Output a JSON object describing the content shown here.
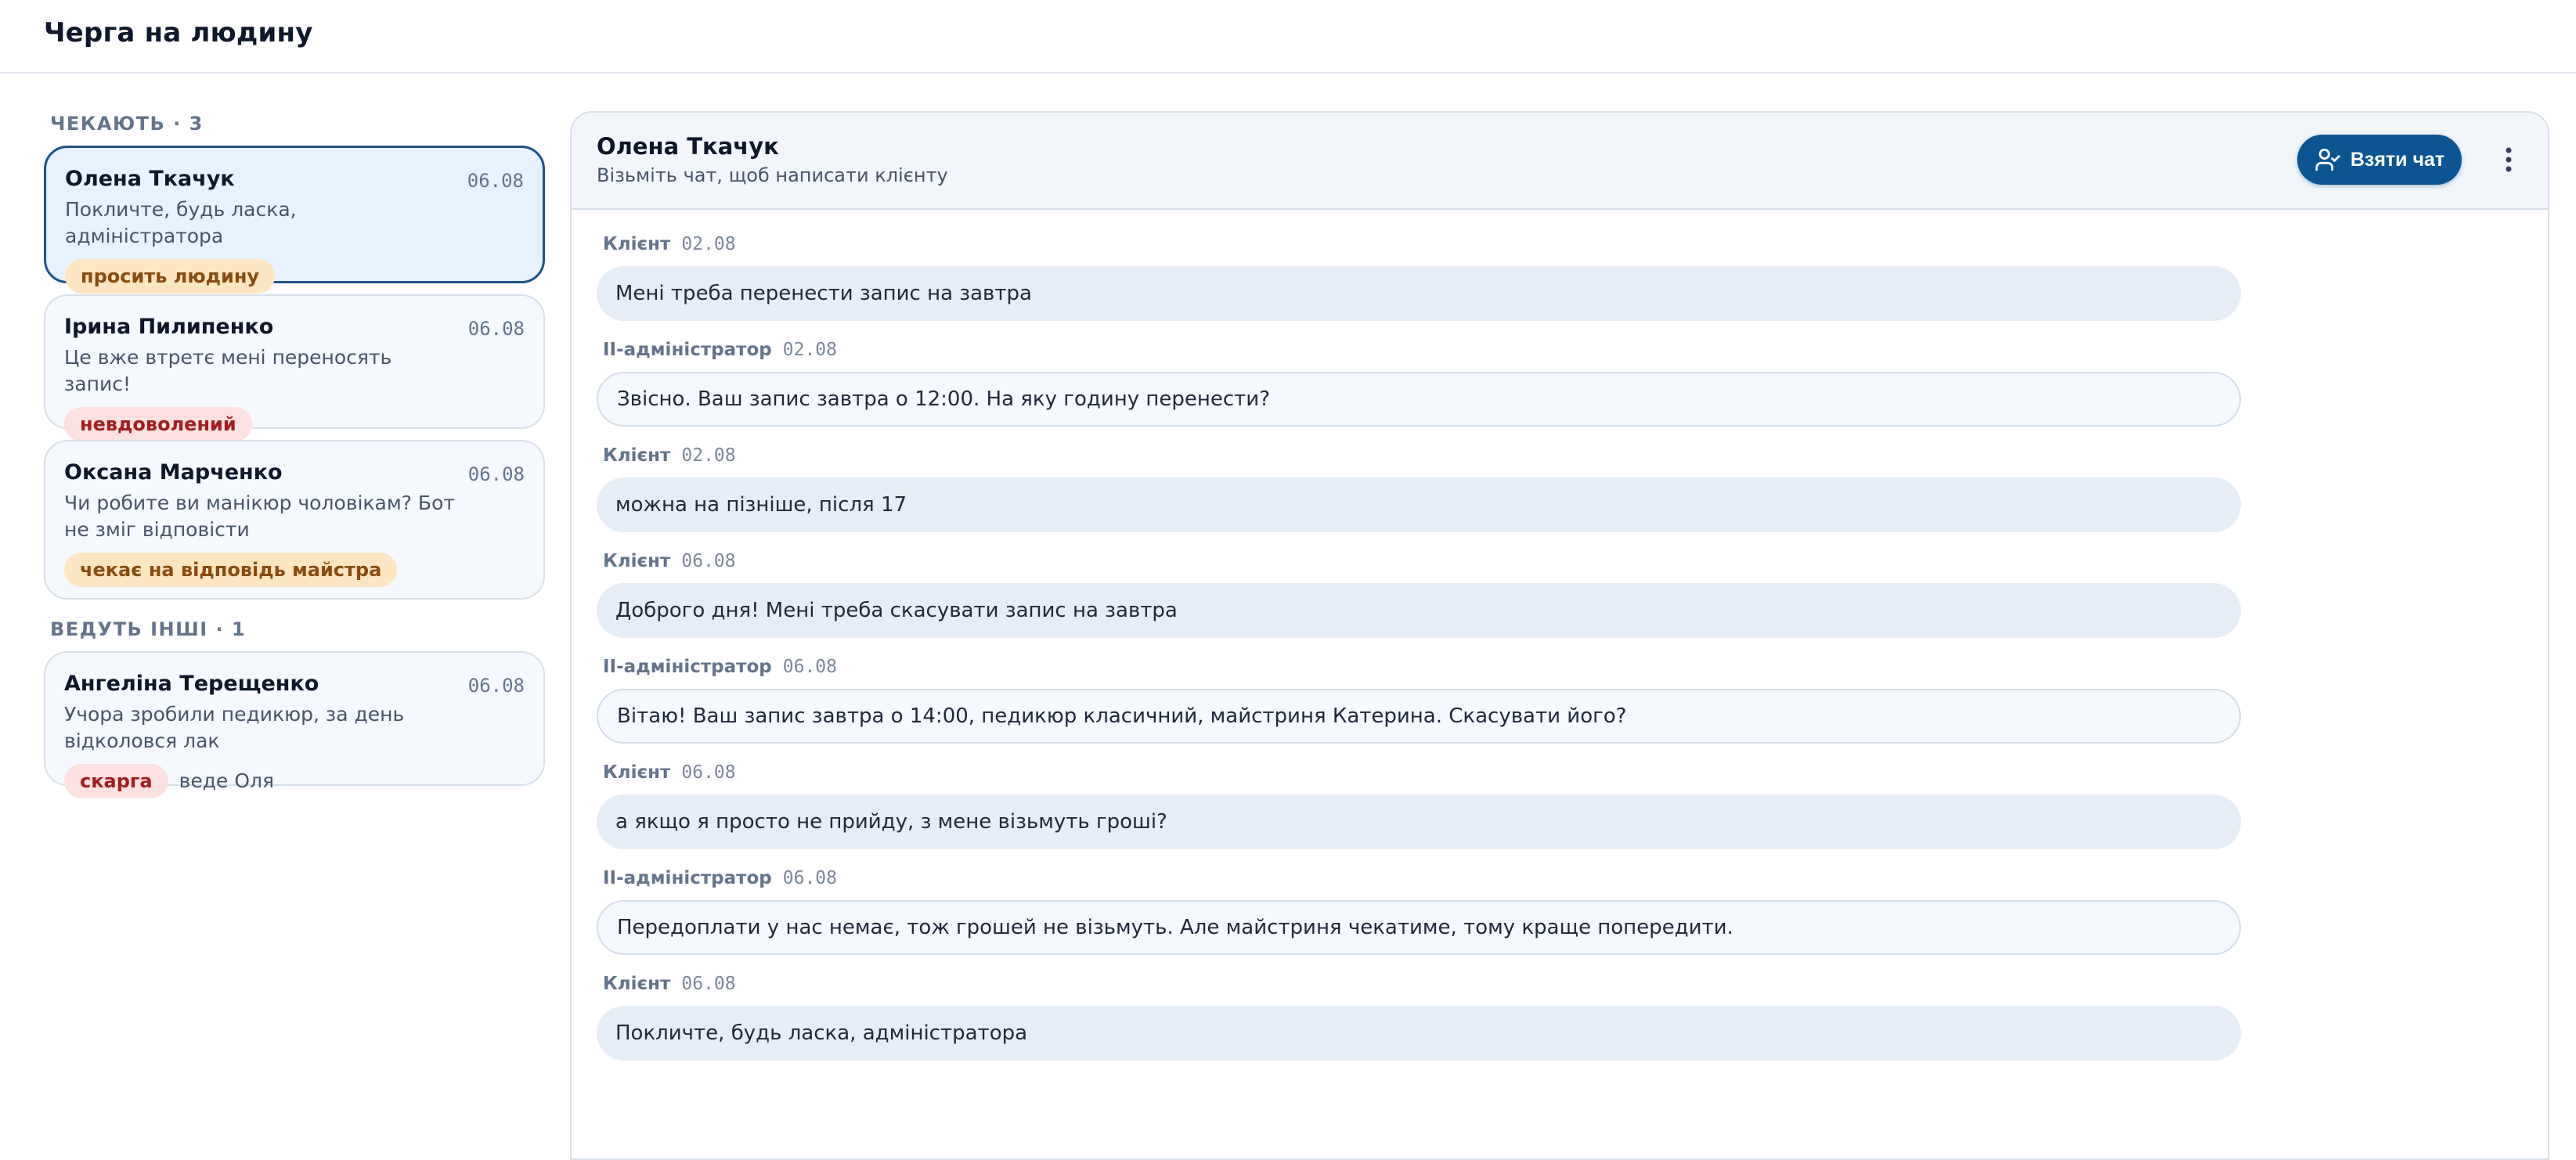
{
  "header": {
    "title": "Черга на людину"
  },
  "queue": {
    "waiting_label": "ЧЕКАЮТЬ · 3",
    "others_label": "ВЕДУТЬ ІНШІ · 1",
    "waiting": [
      {
        "name": "Олена Ткачук",
        "date": "06.08",
        "preview": "Покличте, будь ласка, адміністратора",
        "tag": "просить людину",
        "tag_color": "#fde5c2"
      },
      {
        "name": "Ірина Пилипенко",
        "date": "06.08",
        "preview": "Це вже втретє мені переносять запис!",
        "tag": "невдоволений",
        "tag_color": "#fde0e0"
      },
      {
        "name": "Оксана Марченко",
        "date": "06.08",
        "preview": "Чи робите ви манікюр чоловікам? Бот не зміг відповісти",
        "tag": "чекає на відповідь майстра",
        "tag_color": "#fde5c2"
      }
    ],
    "others": [
      {
        "name": "Ангеліна Терещенко",
        "date": "06.08",
        "preview": "Учора зробили педикюр, за день відколовся лак",
        "tag": "скарга",
        "tag_color": "#fde0e0",
        "owner": "веде Оля"
      }
    ]
  },
  "chat": {
    "name": "Олена Ткачук",
    "subtitle": "Візьміть чат, щоб написати клієнту",
    "take_button": "Взяти чат",
    "icons": {
      "take": "user-check-icon",
      "more": "more-vertical-icon"
    },
    "accent_color": "#0c5592",
    "messages": [
      {
        "sender": "Клієнт",
        "time": "02.08",
        "text": "Мені треба перенести запис на завтра",
        "kind": "client"
      },
      {
        "sender": "ІІ-адміністратор",
        "time": "02.08",
        "text": "Звісно. Ваш запис завтра о 12:00. На яку годину перенести?",
        "kind": "ai"
      },
      {
        "sender": "Клієнт",
        "time": "02.08",
        "text": "можна на пізніше, після 17",
        "kind": "client"
      },
      {
        "sender": "Клієнт",
        "time": "06.08",
        "text": "Доброго дня! Мені треба скасувати запис на завтра",
        "kind": "client"
      },
      {
        "sender": "ІІ-адміністратор",
        "time": "06.08",
        "text": "Вітаю! Ваш запис завтра о 14:00, педикюр класичний, майстриня Катерина. Скасувати його?",
        "kind": "ai"
      },
      {
        "sender": "Клієнт",
        "time": "06.08",
        "text": "а якщо я просто не прийду, з мене візьмуть гроші?",
        "kind": "client"
      },
      {
        "sender": "ІІ-адміністратор",
        "time": "06.08",
        "text": "Передоплати у нас немає, тож грошей не візьмуть. Але майстриня чекатиме, тому краще попередити.",
        "kind": "ai"
      },
      {
        "sender": "Клієнт",
        "time": "06.08",
        "text": "Покличте, будь ласка, адміністратора",
        "kind": "client"
      }
    ]
  }
}
